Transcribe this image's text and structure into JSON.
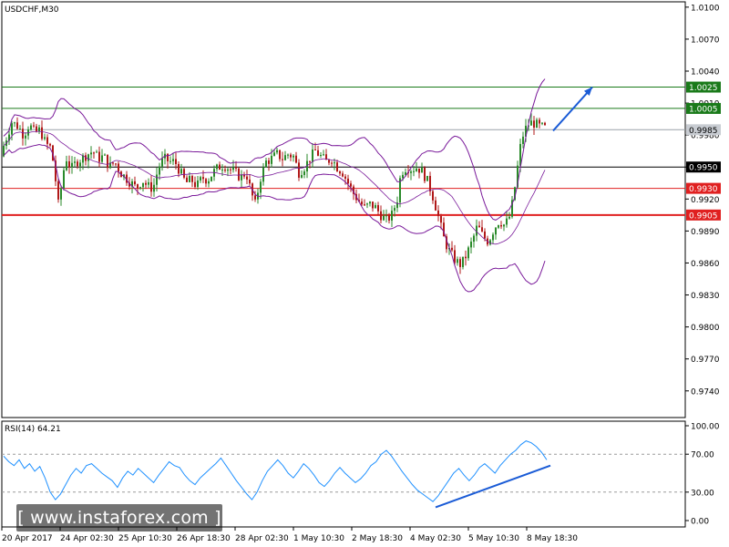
{
  "chart_data": [
    {
      "type": "candlestick",
      "title": "USDCHF,M30",
      "x_ticks": [
        "20 Apr 2017",
        "24 Apr 02:30",
        "25 Apr 10:30",
        "26 Apr 18:30",
        "28 Apr 02:30",
        "1 May 10:30",
        "2 May 18:30",
        "4 May 02:30",
        "5 May 10:30",
        "8 May 18:30"
      ],
      "y_ticks": [
        "1.0100",
        "1.0070",
        "1.0040",
        "1.0010",
        "0.9980",
        "0.9950",
        "0.9920",
        "0.9890",
        "0.9860",
        "0.9830",
        "0.9800",
        "0.9770",
        "0.9740"
      ],
      "ylim": [
        0.9715,
        1.0105
      ],
      "current_price": "0.9985",
      "levels": [
        {
          "label": "1.0025",
          "value": 1.0025,
          "color": "#1a7a1a"
        },
        {
          "label": "1.0005",
          "value": 1.0005,
          "color": "#1a7a1a"
        },
        {
          "label": "0.9950",
          "value": 0.995,
          "color": "#000000"
        },
        {
          "label": "0.9930",
          "value": 0.993,
          "color": "#e02020"
        },
        {
          "label": "0.9905",
          "value": 0.9905,
          "color": "#e02020"
        }
      ],
      "price_path": [
        [
          0,
          0.996
        ],
        [
          6,
          0.9975
        ],
        [
          13,
          0.9992
        ],
        [
          20,
          0.9988
        ],
        [
          26,
          0.998
        ],
        [
          32,
          0.999
        ],
        [
          38,
          0.9982
        ],
        [
          44,
          0.9985
        ],
        [
          50,
          0.9972
        ],
        [
          56,
          0.9968
        ],
        [
          60,
          0.9945
        ],
        [
          64,
          0.9915
        ],
        [
          68,
          0.9935
        ],
        [
          72,
          0.996
        ],
        [
          78,
          0.9948
        ],
        [
          84,
          0.9955
        ],
        [
          90,
          0.9958
        ],
        [
          96,
          0.9962
        ],
        [
          102,
          0.9965
        ],
        [
          108,
          0.9958
        ],
        [
          114,
          0.996
        ],
        [
          120,
          0.995
        ],
        [
          126,
          0.9955
        ],
        [
          132,
          0.9945
        ],
        [
          138,
          0.994
        ],
        [
          144,
          0.9935
        ],
        [
          150,
          0.993
        ],
        [
          156,
          0.9938
        ],
        [
          162,
          0.9932
        ],
        [
          168,
          0.993
        ],
        [
          174,
          0.995
        ],
        [
          180,
          0.9958
        ],
        [
          186,
          0.9955
        ],
        [
          192,
          0.9955
        ],
        [
          198,
          0.9945
        ],
        [
          204,
          0.9935
        ],
        [
          210,
          0.9938
        ],
        [
          216,
          0.9932
        ],
        [
          222,
          0.994
        ],
        [
          228,
          0.9938
        ],
        [
          234,
          0.9945
        ],
        [
          240,
          0.995
        ],
        [
          246,
          0.9952
        ],
        [
          252,
          0.9948
        ],
        [
          258,
          0.9945
        ],
        [
          264,
          0.994
        ],
        [
          270,
          0.9945
        ],
        [
          276,
          0.9925
        ],
        [
          280,
          0.9915
        ],
        [
          286,
          0.994
        ],
        [
          292,
          0.9955
        ],
        [
          298,
          0.9958
        ],
        [
          304,
          0.9962
        ],
        [
          310,
          0.9958
        ],
        [
          316,
          0.9962
        ],
        [
          322,
          0.996
        ],
        [
          328,
          0.9945
        ],
        [
          334,
          0.995
        ],
        [
          340,
          0.9958
        ],
        [
          346,
          0.9965
        ],
        [
          352,
          0.996
        ],
        [
          358,
          0.9955
        ],
        [
          364,
          0.9958
        ],
        [
          370,
          0.995
        ],
        [
          376,
          0.9945
        ],
        [
          382,
          0.9935
        ],
        [
          388,
          0.9925
        ],
        [
          394,
          0.9918
        ],
        [
          400,
          0.9912
        ],
        [
          406,
          0.9915
        ],
        [
          412,
          0.9912
        ],
        [
          418,
          0.9905
        ],
        [
          424,
          0.99
        ],
        [
          430,
          0.9905
        ],
        [
          436,
          0.992
        ],
        [
          440,
          0.9945
        ],
        [
          446,
          0.995
        ],
        [
          452,
          0.9948
        ],
        [
          458,
          0.995
        ],
        [
          464,
          0.9945
        ],
        [
          470,
          0.9935
        ],
        [
          476,
          0.992
        ],
        [
          482,
          0.99
        ],
        [
          488,
          0.988
        ],
        [
          494,
          0.987
        ],
        [
          500,
          0.9862
        ],
        [
          506,
          0.9858
        ],
        [
          512,
          0.9868
        ],
        [
          518,
          0.988
        ],
        [
          524,
          0.9895
        ],
        [
          530,
          0.9885
        ],
        [
          536,
          0.988
        ],
        [
          542,
          0.9892
        ],
        [
          548,
          0.99
        ],
        [
          554,
          0.9895
        ],
        [
          560,
          0.9905
        ],
        [
          564,
          0.9925
        ],
        [
          568,
          0.995
        ],
        [
          572,
          0.9975
        ],
        [
          576,
          0.9985
        ],
        [
          580,
          0.999
        ],
        [
          584,
          0.9992
        ],
        [
          588,
          0.999
        ],
        [
          592,
          0.9988
        ],
        [
          596,
          0.9987
        ],
        [
          600,
          0.9986
        ]
      ],
      "arrow": {
        "from": [
          607,
          0.9984
        ],
        "to": [
          650,
          1.0025
        ],
        "color": "#1a5bd6"
      }
    },
    {
      "type": "line",
      "title": "RSI(14) 64.21",
      "y_ticks": [
        "100.00",
        "70.00",
        "30.00",
        "0.00"
      ],
      "ylim": [
        0,
        100
      ],
      "levels": [
        70,
        30
      ],
      "values": [
        68,
        62,
        58,
        64,
        55,
        60,
        52,
        57,
        45,
        30,
        22,
        28,
        38,
        48,
        55,
        50,
        58,
        60,
        55,
        50,
        46,
        42,
        35,
        45,
        52,
        48,
        55,
        50,
        45,
        40,
        48,
        55,
        62,
        58,
        56,
        48,
        42,
        38,
        45,
        50,
        55,
        60,
        66,
        58,
        50,
        42,
        35,
        28,
        22,
        30,
        42,
        52,
        58,
        64,
        58,
        50,
        45,
        52,
        60,
        55,
        48,
        40,
        36,
        42,
        50,
        56,
        50,
        45,
        40,
        44,
        50,
        58,
        62,
        70,
        74,
        68,
        60,
        52,
        45,
        38,
        32,
        28,
        24,
        20,
        26,
        34,
        42,
        50,
        55,
        48,
        42,
        48,
        56,
        60,
        55,
        50,
        58,
        64,
        70,
        74,
        80,
        84,
        82,
        78,
        72,
        64
      ],
      "trendline": {
        "from": [
          478,
          14
        ],
        "to": [
          604,
          58
        ],
        "color": "#1a5bd6"
      }
    }
  ],
  "watermark": {
    "text": "[  www.instaforex.com  ]"
  }
}
